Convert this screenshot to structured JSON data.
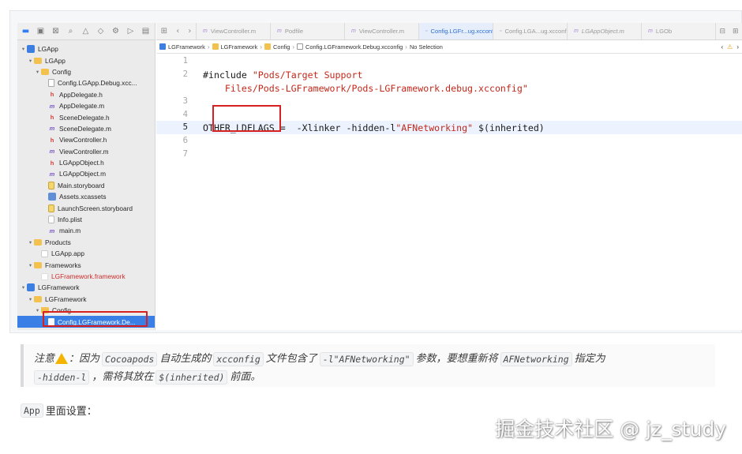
{
  "toolbar_icons": [
    "folder-icon",
    "source-control-icon",
    "symbol-icon",
    "search-icon",
    "issue-icon",
    "test-icon",
    "debug-icon",
    "breakpoint-icon",
    "report-icon"
  ],
  "navigator": {
    "items": [
      {
        "label": "LGApp",
        "icon": "project",
        "disclosure": "▾"
      },
      {
        "label": "LGApp",
        "icon": "folder",
        "disclosure": "▾"
      },
      {
        "label": "Config",
        "icon": "folder",
        "disclosure": "▾"
      },
      {
        "label": "Config.LGApp.Debug.xcc...",
        "icon": "cfg"
      },
      {
        "label": "AppDelegate.h",
        "icon": "h"
      },
      {
        "label": "AppDelegate.m",
        "icon": "m"
      },
      {
        "label": "SceneDelegate.h",
        "icon": "h"
      },
      {
        "label": "SceneDelegate.m",
        "icon": "m"
      },
      {
        "label": "ViewController.h",
        "icon": "h"
      },
      {
        "label": "ViewController.m",
        "icon": "m"
      },
      {
        "label": "LGAppObject.h",
        "icon": "h"
      },
      {
        "label": "LGAppObject.m",
        "icon": "m"
      },
      {
        "label": "Main.storyboard",
        "icon": "sb"
      },
      {
        "label": "Assets.xcassets",
        "icon": "assets"
      },
      {
        "label": "LaunchScreen.storyboard",
        "icon": "sb"
      },
      {
        "label": "Info.plist",
        "icon": "plist"
      },
      {
        "label": "main.m",
        "icon": "m"
      },
      {
        "label": "Products",
        "icon": "folder",
        "disclosure": "▾"
      },
      {
        "label": "LGApp.app",
        "icon": "app"
      },
      {
        "label": "Frameworks",
        "icon": "folder",
        "disclosure": "▾"
      },
      {
        "label": "LGFramework.framework",
        "icon": "fw",
        "red": true
      },
      {
        "label": "LGFramework",
        "icon": "project",
        "disclosure": "▾"
      },
      {
        "label": "LGFramework",
        "icon": "folder",
        "disclosure": "▾"
      },
      {
        "label": "Config",
        "icon": "folder",
        "disclosure": "▾"
      },
      {
        "label": "Config.LGFramework.De...",
        "icon": "cfg",
        "selected": true
      }
    ]
  },
  "tabs": [
    {
      "label": "ViewController.m",
      "type": "m"
    },
    {
      "label": "Podfile",
      "type": "m"
    },
    {
      "label": "ViewController.m",
      "type": "m"
    },
    {
      "label": "Config.LGFr...ug.xcconfig",
      "type": "cfg",
      "active": true
    },
    {
      "label": "Config.LGA...ug.xcconfig",
      "type": "cfg"
    },
    {
      "label": "LGAppObject.m",
      "type": "m",
      "italic": true
    },
    {
      "label": "LGOb",
      "type": "m"
    }
  ],
  "jumpbar": [
    "LGFramework",
    "LGFramework",
    "Config",
    "Config.LGFramework.Debug.xcconfig",
    "No Selection"
  ],
  "code": {
    "line_numbers": [
      "1",
      "2",
      "",
      "3",
      "4",
      "5",
      "6",
      "7"
    ],
    "line2_plain": "#include ",
    "line2_string": "\"Pods/Target Support",
    "line2b_string": "    Files/Pods-LGFramework/Pods-LGFramework.debug.xcconfig\"",
    "line5_plain": "OTHER_LDFLAGS =  -Xlinker -hidden-l",
    "line5_string": "\"AFNetworking\"",
    "line5_tail": " $(inherited)"
  },
  "note": {
    "prefix": "注意",
    "t1": "：因为",
    "c1": "Cocoapods",
    "t2": "自动生成的",
    "c2": "xcconfig",
    "t3": "文件包含了",
    "c3": "-l\"AFNetworking\"",
    "t4": "参数，要想重新将",
    "c4": "AFNetworking",
    "t5": "指定为",
    "c5": "-hidden-l",
    "t6": "，需将其放在",
    "c6": "$(inherited)",
    "t7": "前面。"
  },
  "para": {
    "code": "App",
    "text": "里面设置："
  },
  "watermark": "掘金技术社区 @ jz_study",
  "colors": {
    "selection": "#3a7fe6",
    "highlight_box": "#d82020",
    "string": "#c4281a",
    "warning": "#f5b400"
  }
}
